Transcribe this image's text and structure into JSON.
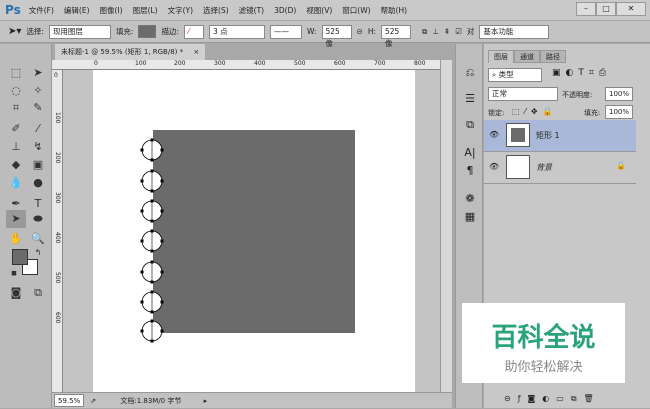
{
  "app": {
    "logo": "Ps",
    "menus": [
      "文件(F)",
      "编辑(E)",
      "图像(I)",
      "图层(L)",
      "文字(Y)",
      "选择(S)",
      "滤镜(T)",
      "3D(D)",
      "视图(V)",
      "窗口(W)",
      "帮助(H)"
    ],
    "window_buttons": [
      "–",
      "□",
      "✕"
    ]
  },
  "options": {
    "select_label": "选择:",
    "select_value": "现用图层",
    "fill_label": "填充:",
    "stroke_label": "描边:",
    "stroke_size": "3 点",
    "w_label": "W:",
    "w_value": "525 像",
    "h_label": "H:",
    "h_value": "525 像",
    "align_label": "对",
    "workspace": "基本功能",
    "fill_color": "#6b6b6b"
  },
  "document": {
    "tab_title": "未标题-1 @ 59.5% (矩形 1, RGB/8) *",
    "close": "×",
    "ruler_top": [
      "0",
      "100",
      "200",
      "300",
      "400",
      "500",
      "600",
      "700",
      "800"
    ],
    "ruler_left": [
      "0",
      "100",
      "200",
      "300",
      "400",
      "500",
      "600"
    ],
    "shape_color": "#6b6b6b"
  },
  "status": {
    "zoom": "59.5%",
    "doc_info": "文档:1.83M/0 字节"
  },
  "layers_panel": {
    "tabs": [
      "图层",
      "通道",
      "路径"
    ],
    "filter": "类型",
    "blend_mode": "正常",
    "opacity_label": "不透明度:",
    "opacity": "100%",
    "lock_label": "锁定:",
    "fill_label": "填充:",
    "fill": "100%",
    "layers": [
      {
        "name": "矩形 1",
        "selected": true
      },
      {
        "name": "背景",
        "locked": true
      }
    ]
  },
  "watermark": {
    "title": "百科全说",
    "subtitle": "助你轻松解决"
  }
}
